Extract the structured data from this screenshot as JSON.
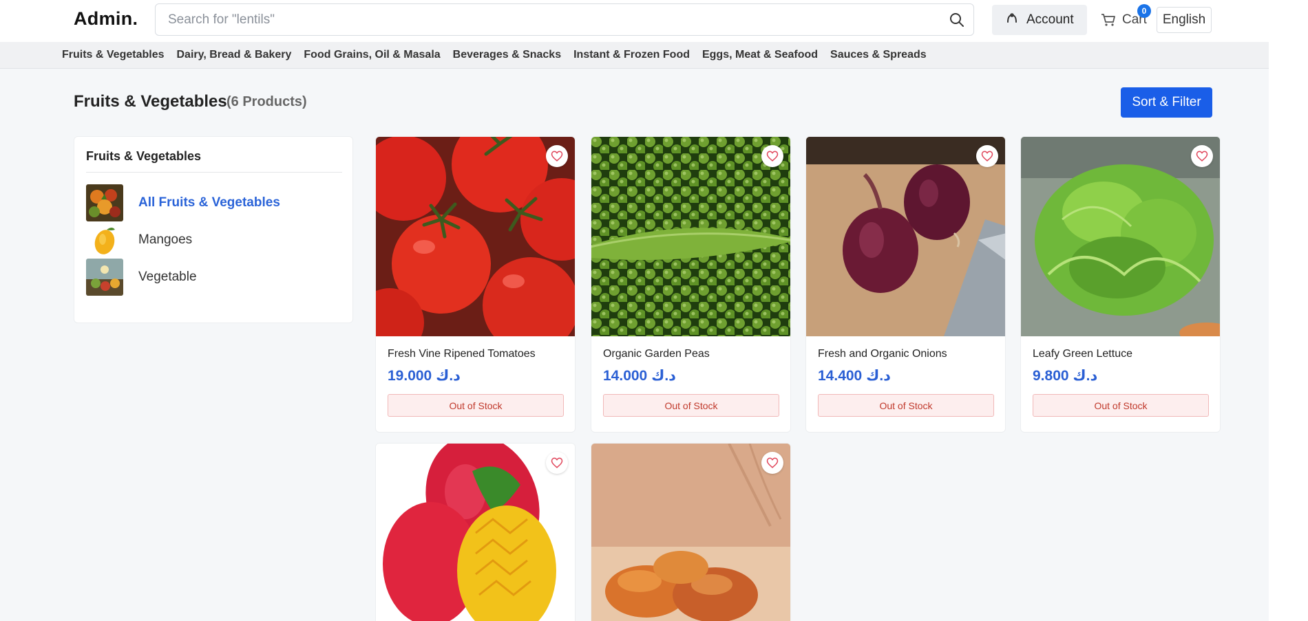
{
  "header": {
    "logo": "Admin.",
    "search_placeholder": "Search for \"lentils\"",
    "account_label": "Account",
    "cart_label": "Cart",
    "cart_count": "0",
    "language_label": "English"
  },
  "categories": [
    "Fruits & Vegetables",
    "Dairy, Bread & Bakery",
    "Food Grains, Oil & Masala",
    "Beverages & Snacks",
    "Instant & Frozen Food",
    "Eggs, Meat & Seafood",
    "Sauces & Spreads"
  ],
  "main": {
    "title": "Fruits & Vegetables",
    "count": "(6 Products)",
    "sort_filter_label": "Sort & Filter"
  },
  "sidebar": {
    "title": "Fruits & Vegetables",
    "items": [
      {
        "label": "All Fruits & Vegetables",
        "active": true
      },
      {
        "label": "Mangoes",
        "active": false
      },
      {
        "label": "Vegetable",
        "active": false
      }
    ]
  },
  "products": [
    {
      "name": "Fresh Vine Ripened Tomatoes",
      "price": "19.000 د.ك",
      "stock": "Out of Stock"
    },
    {
      "name": "Organic Garden Peas",
      "price": "14.000 د.ك",
      "stock": "Out of Stock"
    },
    {
      "name": "Fresh and Organic Onions",
      "price": "14.400 د.ك",
      "stock": "Out of Stock"
    },
    {
      "name": "Leafy Green Lettuce",
      "price": "9.800 د.ك",
      "stock": "Out of Stock"
    },
    {
      "name": "",
      "price": "",
      "stock": ""
    },
    {
      "name": "",
      "price": "",
      "stock": ""
    }
  ],
  "colors": {
    "accent": "#1a5ee8",
    "price": "#2a5fd4",
    "out_of_stock": "#c0392b",
    "wishlist": "#e0455a"
  }
}
